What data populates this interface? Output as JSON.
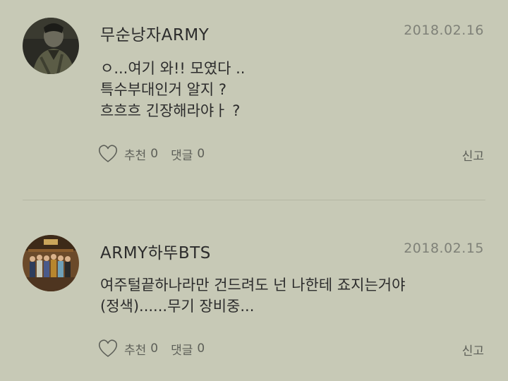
{
  "comments": [
    {
      "username": "무순낭자ARMY",
      "date": "2018.02.16",
      "lines": [
        "ㅇ...여기 와!!  모였다 ..",
        "특수부대인거 알지 ?",
        "흐흐흐 긴장해라야ㅏ ?"
      ],
      "recommend_label": "추천",
      "recommend_count": "0",
      "reply_label": "댓글",
      "reply_count": "0",
      "report_label": "신고",
      "avatar_icon": "dark-figure-avatar"
    },
    {
      "username": "ARMY하뚜BTS",
      "date": "2018.02.15",
      "lines": [
        "여주털끝하나라만 건드려도 넌 나한테 죠지는거야",
        "(정색)......무기 장비중..."
      ],
      "recommend_label": "추천",
      "recommend_count": "0",
      "reply_label": "댓글",
      "reply_count": "0",
      "report_label": "신고",
      "avatar_icon": "group-photo-avatar"
    }
  ],
  "colors": {
    "background": "#c7c9b6",
    "text": "#2c2c2c",
    "muted": "#7f8178",
    "divider": "#b3b5a3"
  }
}
